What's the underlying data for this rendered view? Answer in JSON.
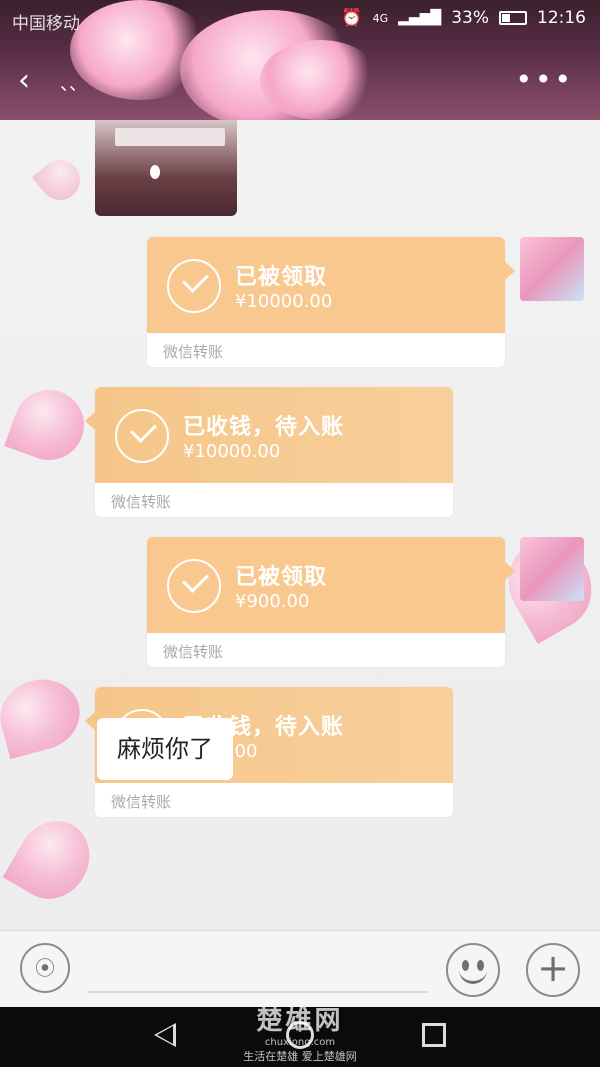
{
  "status_bar": {
    "carrier": "中国移动",
    "network": "4G",
    "battery": "33%",
    "time": "12:16"
  },
  "header": {
    "title": "、、",
    "back_icon": "chevron-left-icon",
    "more_icon": "more-dots-icon"
  },
  "messages": [
    {
      "type": "image",
      "side": "left"
    },
    {
      "type": "transfer",
      "side": "right",
      "status": "已被领取",
      "amount": "¥10000.00",
      "footer": "微信转账"
    },
    {
      "type": "transfer",
      "side": "left",
      "status": "已收钱，待入账",
      "amount": "¥10000.00",
      "footer": "微信转账"
    },
    {
      "type": "transfer",
      "side": "right",
      "status": "已被领取",
      "amount": "¥900.00",
      "footer": "微信转账"
    },
    {
      "type": "transfer",
      "side": "left",
      "status": "已收钱，待入账",
      "amount": "¥900.00",
      "footer": "微信转账"
    },
    {
      "type": "text",
      "side": "left",
      "text": "麻烦你了"
    }
  ],
  "input_bar": {
    "voice_icon": "voice-icon",
    "emoji_icon": "emoji-icon",
    "plus_icon": "plus-icon"
  },
  "watermark": {
    "logo_text": "楚雄网",
    "domain": "chuxiong.com",
    "slogan": "生活在楚雄  爱上楚雄网"
  },
  "colors": {
    "transfer_orange": "#f8c88f",
    "header_dark": "#3a1f2c",
    "petal_pink": "#f7b3cf"
  }
}
